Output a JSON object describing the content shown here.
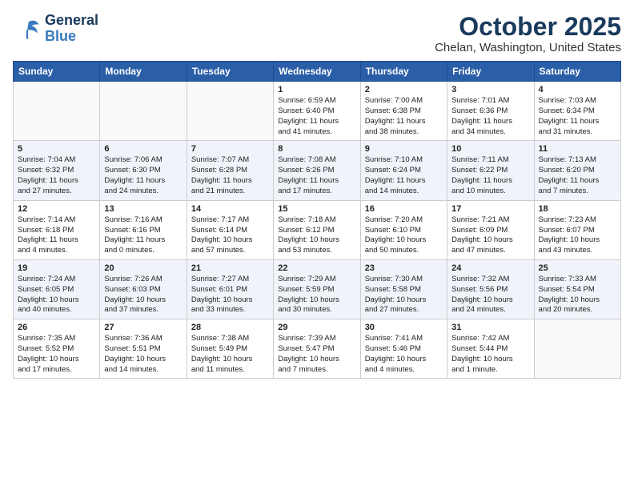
{
  "header": {
    "logo_line1": "General",
    "logo_line2": "Blue",
    "month": "October 2025",
    "location": "Chelan, Washington, United States"
  },
  "weekdays": [
    "Sunday",
    "Monday",
    "Tuesday",
    "Wednesday",
    "Thursday",
    "Friday",
    "Saturday"
  ],
  "weeks": [
    [
      {
        "day": "",
        "info": ""
      },
      {
        "day": "",
        "info": ""
      },
      {
        "day": "",
        "info": ""
      },
      {
        "day": "1",
        "info": "Sunrise: 6:59 AM\nSunset: 6:40 PM\nDaylight: 11 hours\nand 41 minutes."
      },
      {
        "day": "2",
        "info": "Sunrise: 7:00 AM\nSunset: 6:38 PM\nDaylight: 11 hours\nand 38 minutes."
      },
      {
        "day": "3",
        "info": "Sunrise: 7:01 AM\nSunset: 6:36 PM\nDaylight: 11 hours\nand 34 minutes."
      },
      {
        "day": "4",
        "info": "Sunrise: 7:03 AM\nSunset: 6:34 PM\nDaylight: 11 hours\nand 31 minutes."
      }
    ],
    [
      {
        "day": "5",
        "info": "Sunrise: 7:04 AM\nSunset: 6:32 PM\nDaylight: 11 hours\nand 27 minutes."
      },
      {
        "day": "6",
        "info": "Sunrise: 7:06 AM\nSunset: 6:30 PM\nDaylight: 11 hours\nand 24 minutes."
      },
      {
        "day": "7",
        "info": "Sunrise: 7:07 AM\nSunset: 6:28 PM\nDaylight: 11 hours\nand 21 minutes."
      },
      {
        "day": "8",
        "info": "Sunrise: 7:08 AM\nSunset: 6:26 PM\nDaylight: 11 hours\nand 17 minutes."
      },
      {
        "day": "9",
        "info": "Sunrise: 7:10 AM\nSunset: 6:24 PM\nDaylight: 11 hours\nand 14 minutes."
      },
      {
        "day": "10",
        "info": "Sunrise: 7:11 AM\nSunset: 6:22 PM\nDaylight: 11 hours\nand 10 minutes."
      },
      {
        "day": "11",
        "info": "Sunrise: 7:13 AM\nSunset: 6:20 PM\nDaylight: 11 hours\nand 7 minutes."
      }
    ],
    [
      {
        "day": "12",
        "info": "Sunrise: 7:14 AM\nSunset: 6:18 PM\nDaylight: 11 hours\nand 4 minutes."
      },
      {
        "day": "13",
        "info": "Sunrise: 7:16 AM\nSunset: 6:16 PM\nDaylight: 11 hours\nand 0 minutes."
      },
      {
        "day": "14",
        "info": "Sunrise: 7:17 AM\nSunset: 6:14 PM\nDaylight: 10 hours\nand 57 minutes."
      },
      {
        "day": "15",
        "info": "Sunrise: 7:18 AM\nSunset: 6:12 PM\nDaylight: 10 hours\nand 53 minutes."
      },
      {
        "day": "16",
        "info": "Sunrise: 7:20 AM\nSunset: 6:10 PM\nDaylight: 10 hours\nand 50 minutes."
      },
      {
        "day": "17",
        "info": "Sunrise: 7:21 AM\nSunset: 6:09 PM\nDaylight: 10 hours\nand 47 minutes."
      },
      {
        "day": "18",
        "info": "Sunrise: 7:23 AM\nSunset: 6:07 PM\nDaylight: 10 hours\nand 43 minutes."
      }
    ],
    [
      {
        "day": "19",
        "info": "Sunrise: 7:24 AM\nSunset: 6:05 PM\nDaylight: 10 hours\nand 40 minutes."
      },
      {
        "day": "20",
        "info": "Sunrise: 7:26 AM\nSunset: 6:03 PM\nDaylight: 10 hours\nand 37 minutes."
      },
      {
        "day": "21",
        "info": "Sunrise: 7:27 AM\nSunset: 6:01 PM\nDaylight: 10 hours\nand 33 minutes."
      },
      {
        "day": "22",
        "info": "Sunrise: 7:29 AM\nSunset: 5:59 PM\nDaylight: 10 hours\nand 30 minutes."
      },
      {
        "day": "23",
        "info": "Sunrise: 7:30 AM\nSunset: 5:58 PM\nDaylight: 10 hours\nand 27 minutes."
      },
      {
        "day": "24",
        "info": "Sunrise: 7:32 AM\nSunset: 5:56 PM\nDaylight: 10 hours\nand 24 minutes."
      },
      {
        "day": "25",
        "info": "Sunrise: 7:33 AM\nSunset: 5:54 PM\nDaylight: 10 hours\nand 20 minutes."
      }
    ],
    [
      {
        "day": "26",
        "info": "Sunrise: 7:35 AM\nSunset: 5:52 PM\nDaylight: 10 hours\nand 17 minutes."
      },
      {
        "day": "27",
        "info": "Sunrise: 7:36 AM\nSunset: 5:51 PM\nDaylight: 10 hours\nand 14 minutes."
      },
      {
        "day": "28",
        "info": "Sunrise: 7:38 AM\nSunset: 5:49 PM\nDaylight: 10 hours\nand 11 minutes."
      },
      {
        "day": "29",
        "info": "Sunrise: 7:39 AM\nSunset: 5:47 PM\nDaylight: 10 hours\nand 7 minutes."
      },
      {
        "day": "30",
        "info": "Sunrise: 7:41 AM\nSunset: 5:46 PM\nDaylight: 10 hours\nand 4 minutes."
      },
      {
        "day": "31",
        "info": "Sunrise: 7:42 AM\nSunset: 5:44 PM\nDaylight: 10 hours\nand 1 minute."
      },
      {
        "day": "",
        "info": ""
      }
    ]
  ]
}
